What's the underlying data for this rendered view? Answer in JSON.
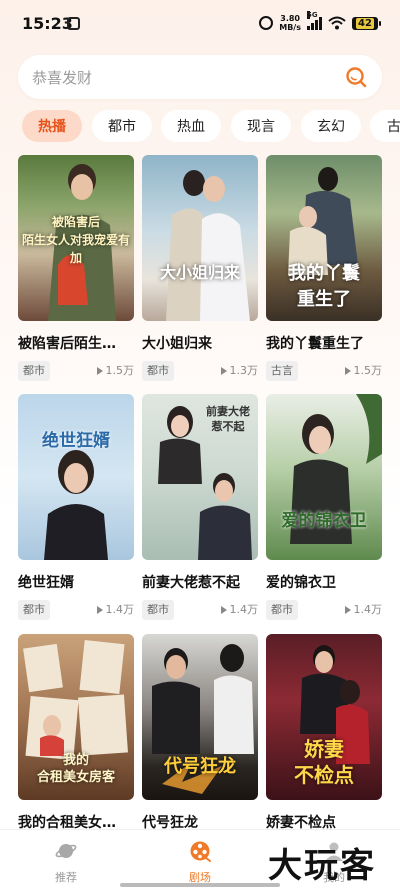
{
  "status_bar": {
    "time": "15:23",
    "net_speed_value": "3.80",
    "net_speed_unit": "MB/s",
    "signal_label": "5G",
    "battery": "42"
  },
  "search": {
    "placeholder": "恭喜发财"
  },
  "categories": [
    {
      "label": "热播",
      "active": true
    },
    {
      "label": "都市"
    },
    {
      "label": "热血"
    },
    {
      "label": "现言"
    },
    {
      "label": "玄幻"
    },
    {
      "label": "古"
    }
  ],
  "dramas": [
    {
      "title": "被陷害后陌生…",
      "poster_text": "被陷害后\n陌生女人对我宠爱有加",
      "tag": "都市",
      "plays": "1.5万"
    },
    {
      "title": "大小姐归来",
      "poster_text": "大小姐归来",
      "tag": "都市",
      "plays": "1.3万"
    },
    {
      "title": "我的丫鬟重生了",
      "poster_text": "我的丫鬟\n重生了",
      "tag": "古言",
      "plays": "1.5万"
    },
    {
      "title": "绝世狂婿",
      "poster_text": "绝世狂婿",
      "tag": "都市",
      "plays": "1.4万"
    },
    {
      "title": "前妻大佬惹不起",
      "poster_text": "前妻大佬 惹不起",
      "tag": "都市",
      "plays": "1.4万"
    },
    {
      "title": "爱的锦衣卫",
      "poster_text": "爱的锦衣卫",
      "tag": "都市",
      "plays": "1.4万"
    },
    {
      "title": "我的合租美女…",
      "poster_text": "我的\n合租美女房客",
      "tag": "",
      "plays": ""
    },
    {
      "title": "代号狂龙",
      "poster_text": "代号狂龙",
      "tag": "",
      "plays": ""
    },
    {
      "title": "娇妻不检点",
      "poster_text": "娇妻\n不检点",
      "tag": "",
      "plays": ""
    }
  ],
  "bottom_nav": [
    {
      "label": "推荐",
      "icon": "planet-icon"
    },
    {
      "label": "剧场",
      "icon": "film-reel-icon",
      "active": true
    },
    {
      "label": "我的",
      "icon": "profile-icon"
    }
  ],
  "watermark": "大玩客",
  "colors": {
    "accent": "#f07a28",
    "chip_active_bg": "#fcd9c8",
    "chip_active_text": "#e8531a"
  }
}
